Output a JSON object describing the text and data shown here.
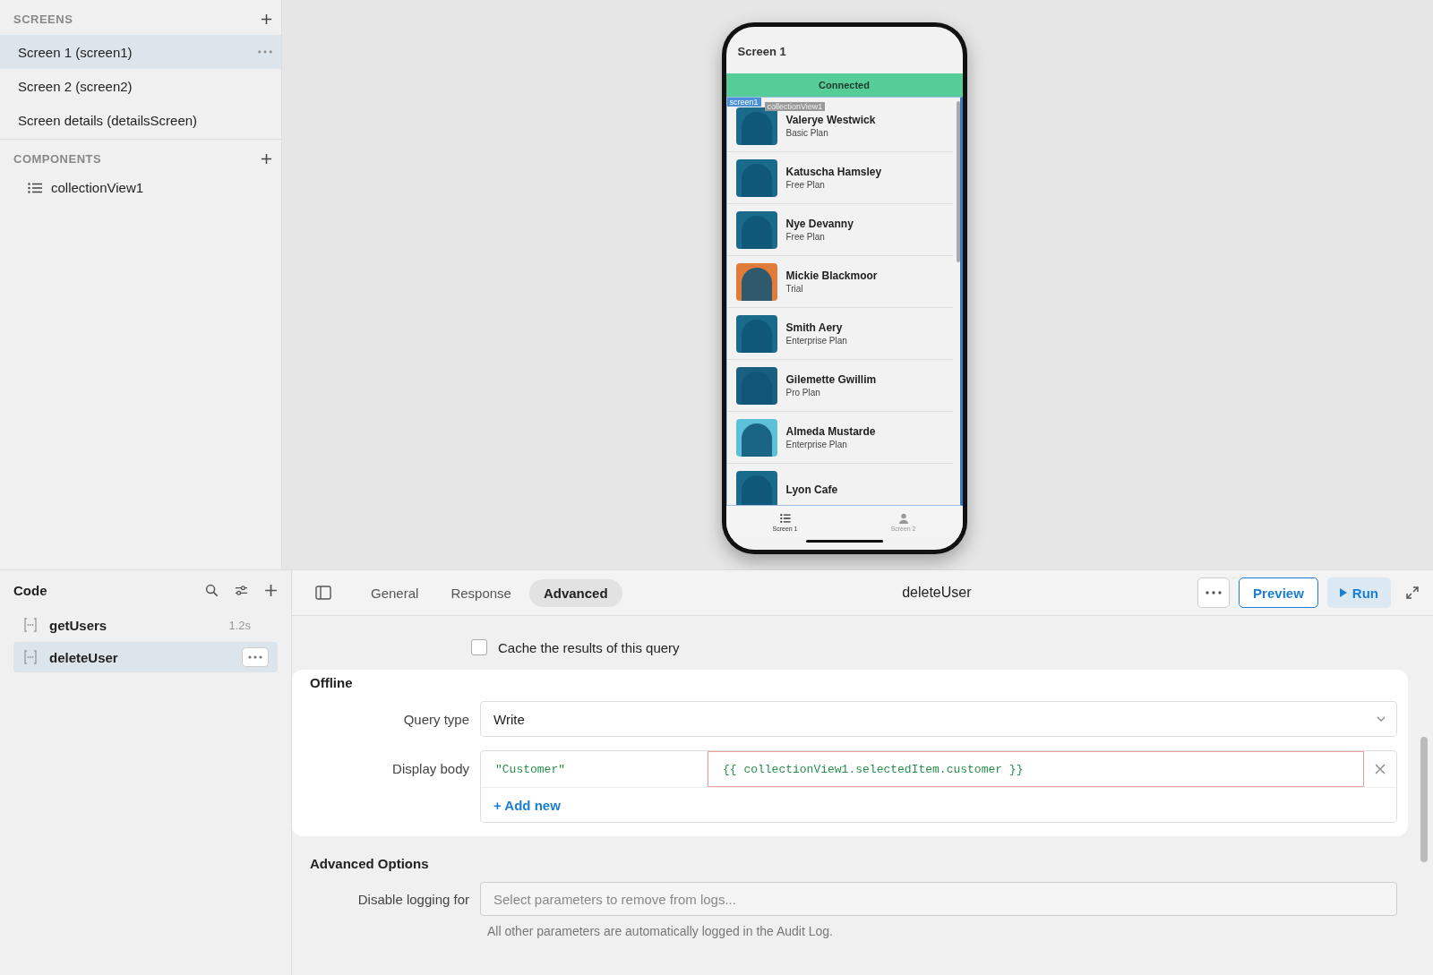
{
  "sidebar": {
    "screens_title": "SCREENS",
    "screens": [
      {
        "label": "Screen 1 (screen1)",
        "selected": true
      },
      {
        "label": "Screen 2 (screen2)",
        "selected": false
      },
      {
        "label": "Screen details (detailsScreen)",
        "selected": false
      }
    ],
    "components_title": "COMPONENTS",
    "components": [
      {
        "label": "collectionView1"
      }
    ]
  },
  "phone": {
    "title": "Screen 1",
    "status": "Connected",
    "screen_tag": "screen1",
    "component_tag": "collectionView1",
    "users": [
      {
        "name": "Valerye Westwick",
        "plan": "Basic Plan",
        "color": "#1a6a8c"
      },
      {
        "name": "Katuscha Hamsley",
        "plan": "Free Plan",
        "color": "#1a6a8c"
      },
      {
        "name": "Nye Devanny",
        "plan": "Free Plan",
        "color": "#1a6a8c"
      },
      {
        "name": "Mickie Blackmoor",
        "plan": "Trial",
        "color": "#e07b39"
      },
      {
        "name": "Smith Aery",
        "plan": "Enterprise Plan",
        "color": "#1a6a8c"
      },
      {
        "name": "Gilemette Gwillim",
        "plan": "Pro Plan",
        "color": "#1a5e80"
      },
      {
        "name": "Almeda Mustarde",
        "plan": "Enterprise Plan",
        "color": "#5bc0d8"
      },
      {
        "name": "Lyon Cafe",
        "color": "#1a6a8c"
      }
    ],
    "tabs": [
      {
        "label": "Screen 1",
        "selected": true
      },
      {
        "label": "Screen 2",
        "selected": false
      }
    ]
  },
  "code": {
    "title": "Code",
    "queries": [
      {
        "name": "getUsers",
        "time": "1.2s",
        "selected": false
      },
      {
        "name": "deleteUser",
        "selected": true
      }
    ]
  },
  "editor": {
    "tabs": [
      {
        "label": "General",
        "selected": false
      },
      {
        "label": "Response",
        "selected": false
      },
      {
        "label": "Advanced",
        "selected": true
      }
    ],
    "title": "deleteUser",
    "preview": "Preview",
    "run": "Run",
    "cache": {
      "label": "Cache the results of this query",
      "checked": false
    },
    "offline": {
      "title": "Offline",
      "query_type_label": "Query type",
      "query_type": "Write",
      "display_body_label": "Display body",
      "body": [
        {
          "key": "\"Customer\"",
          "value": "{{ collectionView1.selectedItem.customer }}"
        }
      ],
      "add_new": "+ Add new"
    },
    "advanced": {
      "title": "Advanced Options",
      "logging_label": "Disable logging for",
      "logging_placeholder": "Select parameters to remove from logs...",
      "hint": "All other parameters are automatically logged in the Audit Log."
    }
  }
}
